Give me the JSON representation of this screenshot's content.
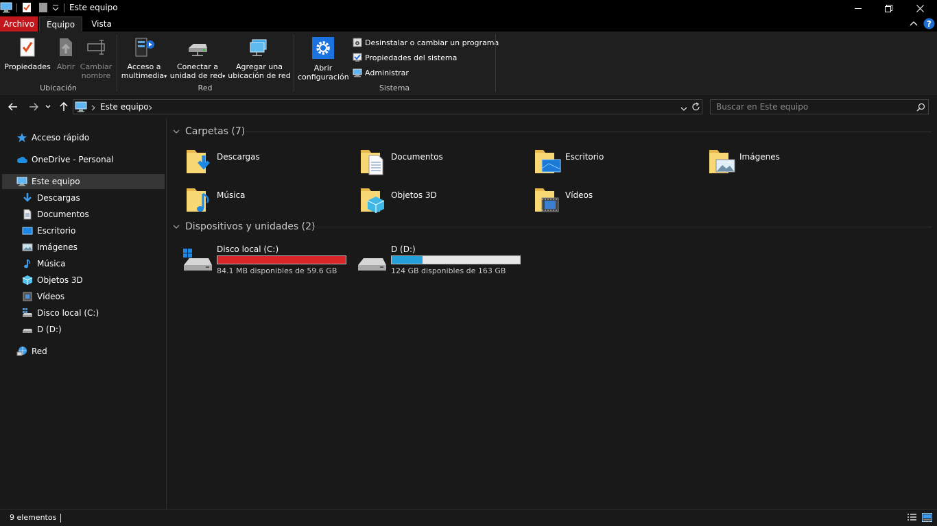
{
  "window": {
    "title": "Este equipo",
    "icon": "this-pc-icon"
  },
  "ribbon_tabs": [
    {
      "label": "Archivo"
    },
    {
      "label": "Equipo"
    },
    {
      "label": "Vista"
    }
  ],
  "ribbon": {
    "ubicacion": {
      "label": "Ubicación",
      "propiedades": "Propiedades",
      "abrir": "Abrir",
      "cambiar_nombre_1": "Cambiar",
      "cambiar_nombre_2": "nombre"
    },
    "red": {
      "label": "Red",
      "acceso_1": "Acceso a",
      "acceso_2": "multimedia",
      "conectar_1": "Conectar a",
      "conectar_2": "unidad de red",
      "agregar_1": "Agregar una",
      "agregar_2": "ubicación de red"
    },
    "sistema": {
      "label": "Sistema",
      "abrir_conf_1": "Abrir",
      "abrir_conf_2": "configuración",
      "desinstalar": "Desinstalar o cambiar un programa",
      "propiedades_sistema": "Propiedades del sistema",
      "administrar": "Administrar"
    }
  },
  "address": {
    "crumb": "Este equipo",
    "search_placeholder": "Buscar en Este equipo"
  },
  "sidebar": {
    "acceso_rapido": "Acceso rápido",
    "onedrive": "OneDrive - Personal",
    "este_equipo": "Este equipo",
    "children": [
      {
        "label": "Descargas",
        "icon": "downloads-icon"
      },
      {
        "label": "Documentos",
        "icon": "documents-icon"
      },
      {
        "label": "Escritorio",
        "icon": "desktop-icon"
      },
      {
        "label": "Imágenes",
        "icon": "pictures-icon"
      },
      {
        "label": "Música",
        "icon": "music-icon"
      },
      {
        "label": "Objetos 3D",
        "icon": "3d-objects-icon"
      },
      {
        "label": "Vídeos",
        "icon": "videos-icon"
      },
      {
        "label": "Disco local (C:)",
        "icon": "drive-c-icon"
      },
      {
        "label": "D (D:)",
        "icon": "drive-d-icon"
      }
    ],
    "red": "Red"
  },
  "main": {
    "folders_header": "Carpetas (7)",
    "folders": [
      {
        "label": "Descargas"
      },
      {
        "label": "Documentos"
      },
      {
        "label": "Escritorio"
      },
      {
        "label": "Imágenes"
      },
      {
        "label": "Música"
      },
      {
        "label": "Objetos 3D"
      },
      {
        "label": "Vídeos"
      }
    ],
    "devices_header": "Dispositivos y unidades (2)",
    "drives": [
      {
        "name": "Disco local (C:)",
        "free_text": "84.1 MB disponibles de 59.6 GB",
        "used_fraction": 0.998,
        "bar_color": "#da2626"
      },
      {
        "name": "D (D:)",
        "free_text": "124 GB disponibles de 163 GB",
        "used_fraction": 0.24,
        "bar_color": "#26a0da"
      }
    ]
  },
  "status": {
    "count": "9 elementos"
  },
  "colors": {
    "archivo_tab": "#c3171e",
    "background": "#191919",
    "accent_blue": "#1e90ff",
    "folder_yellow": "#f8d775"
  }
}
